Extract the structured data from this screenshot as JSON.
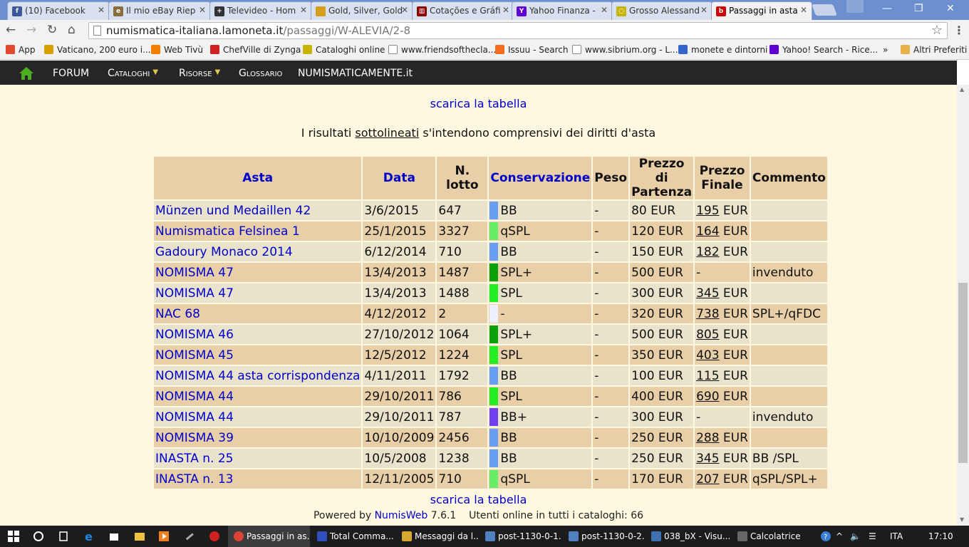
{
  "browser": {
    "tabs": [
      {
        "title": "(10) Facebook",
        "icon": "facebook-icon",
        "color": "#3b5998",
        "glyph": "f"
      },
      {
        "title": "Il mio eBay Riep",
        "icon": "ebay-icon",
        "color": "#8a6d3b",
        "glyph": "e"
      },
      {
        "title": "Televideo - Hom",
        "icon": "rai-icon",
        "color": "#333333",
        "glyph": "+"
      },
      {
        "title": "Gold, Silver, Gold",
        "icon": "shield-icon",
        "color": "#d4a017",
        "glyph": ""
      },
      {
        "title": "Cotações e Gráfi",
        "icon": "chart-icon",
        "color": "#8b0000",
        "glyph": "▥"
      },
      {
        "title": "Yahoo Finanza -",
        "icon": "yahoo-icon",
        "color": "#5f01d1",
        "glyph": "Y"
      },
      {
        "title": "Grosso Alessand",
        "icon": "coin-icon",
        "color": "#c8b400",
        "glyph": "○"
      },
      {
        "title": "Passaggi in asta",
        "icon": "lamoneta-icon",
        "color": "#cc0000",
        "glyph": "b"
      }
    ],
    "url_host": "numismatica-italiana.lamoneta.it",
    "url_path": "/passaggi/W-ALEVIA/2-8"
  },
  "bookmarks": [
    {
      "label": "App",
      "icon": "apps-grid-icon",
      "color": "#e24a2f"
    },
    {
      "label": "Vaticano, 200 euro i...",
      "icon": "ns-icon",
      "color": "#d6a000"
    },
    {
      "label": "Web Tivù",
      "icon": "blogger-icon",
      "color": "#f57d00"
    },
    {
      "label": "ChefVille di Zynga",
      "icon": "chefville-icon",
      "color": "#cc2222"
    },
    {
      "label": "Cataloghi online",
      "icon": "coin-icon",
      "color": "#c8b400"
    },
    {
      "label": "www.friendsofthecla...",
      "icon": "page-icon",
      "color": "#ffffff"
    },
    {
      "label": "Issuu - Search",
      "icon": "issuu-icon",
      "color": "#f36d21"
    },
    {
      "label": "www.sibrium.org - L...",
      "icon": "page-icon",
      "color": "#ffffff"
    },
    {
      "label": "monete e dintorni",
      "icon": "calendar-icon",
      "color": "#3366cc"
    },
    {
      "label": "Yahoo! Search - Rice...",
      "icon": "yahoo-icon",
      "color": "#5f01d1"
    },
    {
      "label": "»",
      "icon": "more-chevron-icon",
      "color": "#f2f2f2"
    },
    {
      "label": "Altri Preferiti",
      "icon": "folder-icon",
      "color": "#e8b24a"
    }
  ],
  "sitenav": {
    "items": [
      {
        "label": "FORUM",
        "caret": false,
        "big": true
      },
      {
        "label": "Cataloghi",
        "caret": true,
        "big": false
      },
      {
        "label": "Risorse",
        "caret": true,
        "big": false
      },
      {
        "label": "Glossario",
        "caret": false,
        "big": false
      },
      {
        "label": "NUMISMATICAMENTE.it",
        "caret": false,
        "big": true
      }
    ]
  },
  "content": {
    "download_link": "scarica la tabella",
    "note_before": "I risultati ",
    "note_underlined": "sottolineati",
    "note_after": " s'intendono comprensivi dei diritti d'asta",
    "table": {
      "headers": [
        "Asta",
        "Data",
        "N. lotto",
        "Conservazione",
        "Peso",
        "Prezzo di Partenza",
        "Prezzo Finale",
        "Commento"
      ],
      "rows": [
        {
          "asta": "Münzen und Medaillen 42",
          "data": "3/6/2015",
          "lotto": "647",
          "cons": "BB",
          "cons_color": "#6a9ef5",
          "peso": "-",
          "partenza": "80 EUR",
          "finale": "195",
          "finale_unit": " EUR",
          "commento": ""
        },
        {
          "asta": "Numismatica Felsinea 1",
          "data": "25/1/2015",
          "lotto": "3327",
          "cons": "qSPL",
          "cons_color": "#66ee66",
          "peso": "-",
          "partenza": "120 EUR",
          "finale": "164",
          "finale_unit": " EUR",
          "commento": ""
        },
        {
          "asta": "Gadoury Monaco 2014",
          "data": "6/12/2014",
          "lotto": "710",
          "cons": "BB",
          "cons_color": "#6a9ef5",
          "peso": "-",
          "partenza": "150 EUR",
          "finale": "182",
          "finale_unit": " EUR",
          "commento": ""
        },
        {
          "asta": "NOMISMA 47",
          "data": "13/4/2013",
          "lotto": "1487",
          "cons": "SPL+",
          "cons_color": "#0aa00a",
          "peso": "-",
          "partenza": "500 EUR",
          "finale": "-",
          "finale_unit": "",
          "commento": "invenduto"
        },
        {
          "asta": "NOMISMA 47",
          "data": "13/4/2013",
          "lotto": "1488",
          "cons": "SPL",
          "cons_color": "#22ee22",
          "peso": "-",
          "partenza": "300 EUR",
          "finale": "345",
          "finale_unit": " EUR",
          "commento": ""
        },
        {
          "asta": "NAC 68",
          "data": "4/12/2012",
          "lotto": "2",
          "cons": "-",
          "cons_color": "#eef0ff",
          "peso": "-",
          "partenza": "320 EUR",
          "finale": "738",
          "finale_unit": " EUR",
          "commento": "SPL+/qFDC"
        },
        {
          "asta": "NOMISMA 46",
          "data": "27/10/2012",
          "lotto": "1064",
          "cons": "SPL+",
          "cons_color": "#0aa00a",
          "peso": "-",
          "partenza": "500 EUR",
          "finale": "805",
          "finale_unit": " EUR",
          "commento": ""
        },
        {
          "asta": "NOMISMA 45",
          "data": "12/5/2012",
          "lotto": "1224",
          "cons": "SPL",
          "cons_color": "#22ee22",
          "peso": "-",
          "partenza": "350 EUR",
          "finale": "403",
          "finale_unit": " EUR",
          "commento": ""
        },
        {
          "asta": "NOMISMA 44 asta corrispondenza",
          "data": "4/11/2011",
          "lotto": "1792",
          "cons": "BB",
          "cons_color": "#6a9ef5",
          "peso": "-",
          "partenza": "100 EUR",
          "finale": "115",
          "finale_unit": " EUR",
          "commento": ""
        },
        {
          "asta": "NOMISMA 44",
          "data": "29/10/2011",
          "lotto": "786",
          "cons": "SPL",
          "cons_color": "#22ee22",
          "peso": "-",
          "partenza": "400 EUR",
          "finale": "690",
          "finale_unit": " EUR",
          "commento": ""
        },
        {
          "asta": "NOMISMA 44",
          "data": "29/10/2011",
          "lotto": "787",
          "cons": "BB+",
          "cons_color": "#7040f0",
          "peso": "-",
          "partenza": "300 EUR",
          "finale": "-",
          "finale_unit": "",
          "commento": "invenduto"
        },
        {
          "asta": "NOMISMA 39",
          "data": "10/10/2009",
          "lotto": "2456",
          "cons": "BB",
          "cons_color": "#6a9ef5",
          "peso": "-",
          "partenza": "250 EUR",
          "finale": "288",
          "finale_unit": " EUR",
          "commento": ""
        },
        {
          "asta": "INASTA n. 25",
          "data": "10/5/2008",
          "lotto": "1238",
          "cons": "BB",
          "cons_color": "#6a9ef5",
          "peso": "-",
          "partenza": "250 EUR",
          "finale": "345",
          "finale_unit": " EUR",
          "commento": "BB /SPL"
        },
        {
          "asta": "INASTA n. 13",
          "data": "12/11/2005",
          "lotto": "710",
          "cons": "qSPL",
          "cons_color": "#66ee66",
          "peso": "-",
          "partenza": "170 EUR",
          "finale": "207",
          "finale_unit": " EUR",
          "commento": "qSPL/SPL+"
        }
      ]
    },
    "footer": {
      "powered_by": "Powered by ",
      "numisweb": "NumisWeb",
      "version": " 7.6.1",
      "online": "Utenti online in tutti i cataloghi: 66"
    }
  },
  "taskbar": {
    "items": [
      {
        "label": "Passaggi in as...",
        "icon": "chrome-icon",
        "color": "#db4437",
        "active": true
      },
      {
        "label": "Total Comma...",
        "icon": "floppy-icon",
        "color": "#3050c0",
        "active": false
      },
      {
        "label": "Messaggi da l...",
        "icon": "mail-icon",
        "color": "#d8a830",
        "active": false
      },
      {
        "label": "post-1130-0-1...",
        "icon": "image-icon",
        "color": "#5080c0",
        "active": false
      },
      {
        "label": "post-1130-0-2...",
        "icon": "image-icon",
        "color": "#5080c0",
        "active": false
      },
      {
        "label": "038_bX - Visu...",
        "icon": "image-viewer-icon",
        "color": "#4070b0",
        "active": false
      },
      {
        "label": "Calcolatrice",
        "icon": "calculator-icon",
        "color": "#666666",
        "active": false
      }
    ],
    "language": "ITA",
    "clock": "17:10"
  }
}
